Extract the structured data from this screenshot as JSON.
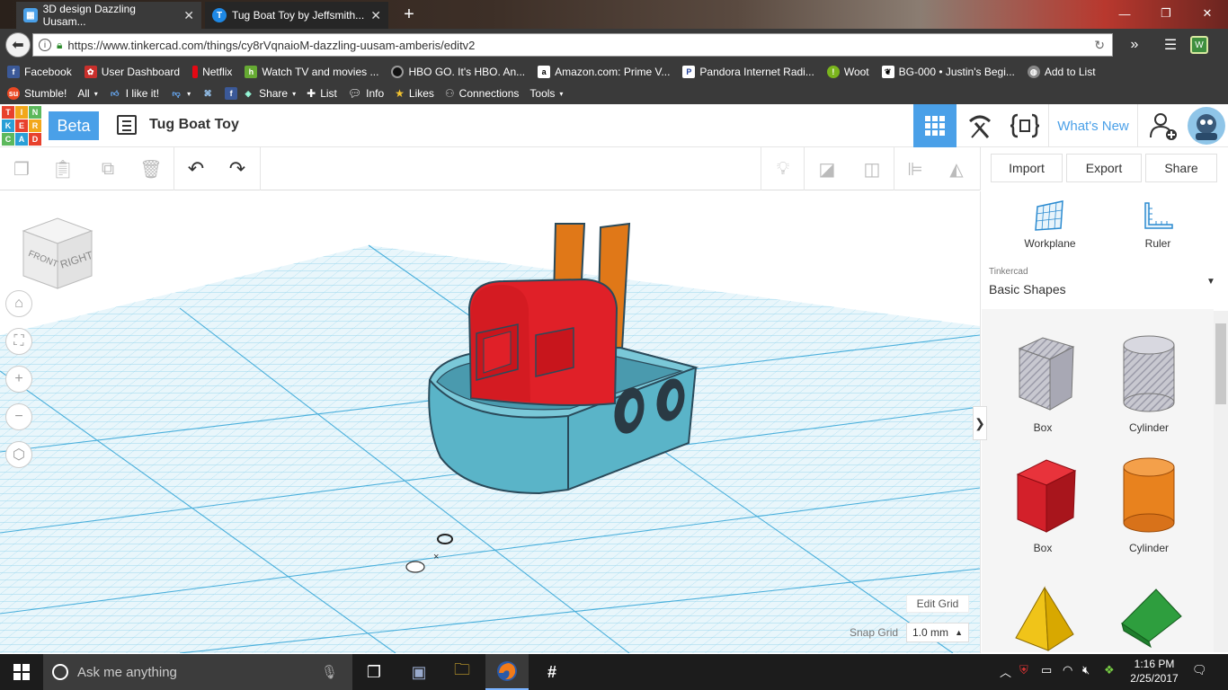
{
  "browser": {
    "tabs": [
      {
        "title": "3D design Dazzling Uusam...",
        "active": true
      },
      {
        "title": "Tug Boat Toy by Jeffsmith...",
        "active": false
      }
    ],
    "url": "https://www.tinkercad.com/things/cy8rVqnaioM-dazzling-uusam-amberis/editv2",
    "bookmarks": [
      "Facebook",
      "User Dashboard",
      "Netflix",
      "Watch TV and movies ...",
      "HBO GO. It's HBO. An...",
      "Amazon.com: Prime V...",
      "Pandora Internet Radi...",
      "Woot",
      "BG-000 • Justin's Begi...",
      "Add to List"
    ],
    "stumble": [
      "Stumble!",
      "All",
      "I like it!",
      "Share",
      "List",
      "Info",
      "Likes",
      "Connections",
      "Tools"
    ]
  },
  "app": {
    "logo_letters": [
      "TIN",
      "KER",
      "CAD"
    ],
    "beta_label": "Beta",
    "design_title": "Tug Boat Toy",
    "whats_new": "What's New"
  },
  "toolbar": {
    "import": "Import",
    "export": "Export",
    "share": "Share"
  },
  "viewcube": {
    "front": "FRONT",
    "right": "RIGHT"
  },
  "grid": {
    "edit_grid": "Edit Grid",
    "snap_label": "Snap Grid",
    "snap_value": "1.0 mm"
  },
  "panel": {
    "workplane": "Workplane",
    "ruler": "Ruler",
    "category_small": "Tinkercad",
    "category": "Basic Shapes",
    "shapes": [
      {
        "label": "Box",
        "color": "#b8b8c0"
      },
      {
        "label": "Cylinder",
        "color": "#b8b8c0"
      },
      {
        "label": "Box",
        "color": "#d3202a"
      },
      {
        "label": "Cylinder",
        "color": "#e8821e"
      },
      {
        "label": "",
        "color": "#f0c419"
      },
      {
        "label": "",
        "color": "#2e9e3e"
      }
    ]
  },
  "taskbar": {
    "search_placeholder": "Ask me anything",
    "time": "1:16 PM",
    "date": "2/25/2017"
  },
  "colors": {
    "accent": "#4aa0e8",
    "grid": "#6ec8e8",
    "hull": "#5ab4c8",
    "cabin": "#e02028",
    "stack": "#e07818"
  }
}
